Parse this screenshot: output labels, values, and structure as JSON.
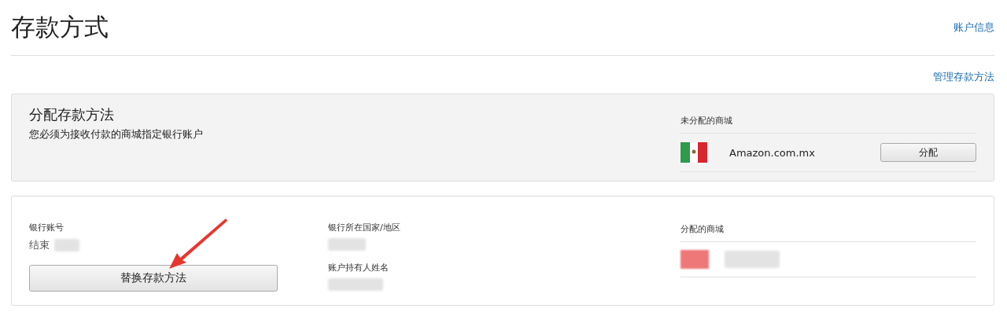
{
  "header": {
    "title": "存款方式",
    "account_link": "账户信息"
  },
  "manage_link": "管理存款方法",
  "assign_panel": {
    "title": "分配存款方法",
    "subtitle": "您必须为接收付款的商城指定银行账户",
    "unassigned_heading": "未分配的商城",
    "stores": [
      {
        "name": "Amazon.com.mx",
        "button": "分配"
      }
    ]
  },
  "method_panel": {
    "account_label": "银行账号",
    "account_value": "结束",
    "replace_button": "替换存款方法",
    "country_label": "银行所在国家/地区",
    "holder_label": "账户持有人姓名",
    "assigned_heading": "分配的商城"
  }
}
